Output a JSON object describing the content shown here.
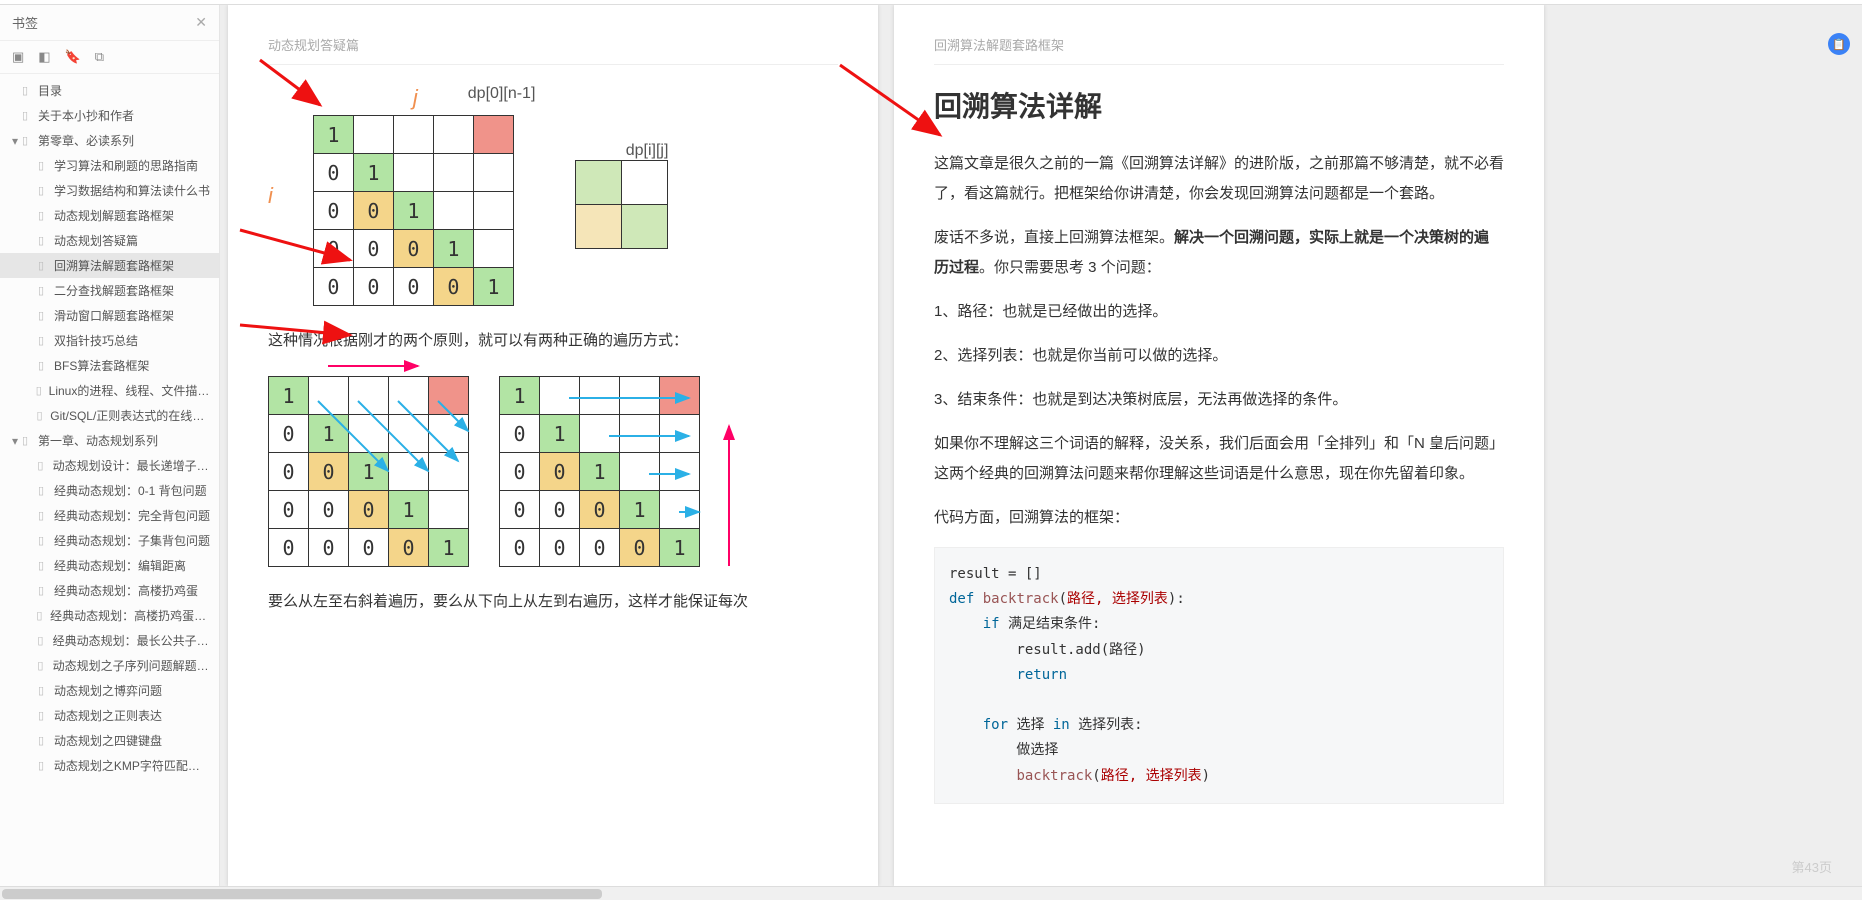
{
  "sidebar": {
    "title": "书签",
    "nodes": [
      {
        "label": "目录",
        "level": 0,
        "selected": false
      },
      {
        "label": "关于本小抄和作者",
        "level": 0
      },
      {
        "label": "第零章、必读系列",
        "level": 0,
        "expandable": true
      },
      {
        "label": "学习算法和刷题的思路指南",
        "level": 1
      },
      {
        "label": "学习数据结构和算法读什么书",
        "level": 1
      },
      {
        "label": "动态规划解题套路框架",
        "level": 1
      },
      {
        "label": "动态规划答疑篇",
        "level": 1
      },
      {
        "label": "回溯算法解题套路框架",
        "level": 1,
        "selected": true
      },
      {
        "label": "二分查找解题套路框架",
        "level": 1
      },
      {
        "label": "滑动窗口解题套路框架",
        "level": 1
      },
      {
        "label": "双指针技巧总结",
        "level": 1
      },
      {
        "label": "BFS算法套路框架",
        "level": 1
      },
      {
        "label": "Linux的进程、线程、文件描述符是什…",
        "level": 1
      },
      {
        "label": "Git/SQL/正则表达式的在线练习平台",
        "level": 1
      },
      {
        "label": "第一章、动态规划系列",
        "level": 0,
        "expandable": true
      },
      {
        "label": "动态规划设计：最长递增子序列",
        "level": 1
      },
      {
        "label": "经典动态规划：0-1 背包问题",
        "level": 1
      },
      {
        "label": "经典动态规划：完全背包问题",
        "level": 1
      },
      {
        "label": "经典动态规划：子集背包问题",
        "level": 1
      },
      {
        "label": "经典动态规划：编辑距离",
        "level": 1
      },
      {
        "label": "经典动态规划：高楼扔鸡蛋",
        "level": 1
      },
      {
        "label": "经典动态规划：高楼扔鸡蛋（进阶）",
        "level": 1
      },
      {
        "label": "经典动态规划：最长公共子序列",
        "level": 1
      },
      {
        "label": "动态规划之子序列问题解题模板",
        "level": 1
      },
      {
        "label": "动态规划之博弈问题",
        "level": 1
      },
      {
        "label": "动态规划之正则表达",
        "level": 1
      },
      {
        "label": "动态规划之四键键盘",
        "level": 1
      },
      {
        "label": "动态规划之KMP字符匹配算法",
        "level": 1
      }
    ]
  },
  "leftPage": {
    "header": "动态规划答疑篇",
    "axis_j": "j",
    "axis_i": "i",
    "dp_top": "dp[0][n-1]",
    "dp_small": "dp[i][j]",
    "mainGrid": [
      [
        {
          "v": "1",
          "c": "cg"
        },
        {
          "v": "",
          "c": ""
        },
        {
          "v": "",
          "c": ""
        },
        {
          "v": "",
          "c": ""
        },
        {
          "v": "",
          "c": "cr"
        }
      ],
      [
        {
          "v": "0",
          "c": ""
        },
        {
          "v": "1",
          "c": "cg"
        },
        {
          "v": "",
          "c": ""
        },
        {
          "v": "",
          "c": ""
        },
        {
          "v": "",
          "c": ""
        }
      ],
      [
        {
          "v": "0",
          "c": ""
        },
        {
          "v": "0",
          "c": "cy"
        },
        {
          "v": "1",
          "c": "cg"
        },
        {
          "v": "",
          "c": ""
        },
        {
          "v": "",
          "c": ""
        }
      ],
      [
        {
          "v": "0",
          "c": ""
        },
        {
          "v": "0",
          "c": ""
        },
        {
          "v": "0",
          "c": "cy"
        },
        {
          "v": "1",
          "c": "cg"
        },
        {
          "v": "",
          "c": ""
        }
      ],
      [
        {
          "v": "0",
          "c": ""
        },
        {
          "v": "0",
          "c": ""
        },
        {
          "v": "0",
          "c": ""
        },
        {
          "v": "0",
          "c": "cy"
        },
        {
          "v": "1",
          "c": "cg"
        }
      ]
    ],
    "smallGrid": [
      [
        {
          "c": "cgl"
        },
        {
          "c": ""
        }
      ],
      [
        {
          "c": "cyl"
        },
        {
          "c": "cgl"
        }
      ]
    ],
    "para1": "这种情况根据刚才的两个原则，就可以有两种正确的遍历方式：",
    "para2": "要么从左至右斜着遍历，要么从下向上从左到右遍历，这样才能保证每次"
  },
  "rightPage": {
    "header": "回溯算法解题套路框架",
    "title": "回溯算法详解",
    "p1": "这篇文章是很久之前的一篇《回溯算法详解》的进阶版，之前那篇不够清楚，就不必看了，看这篇就行。把框架给你讲清楚，你会发现回溯算法问题都是一个套路。",
    "p2a": "废话不多说，直接上回溯算法框架。",
    "p2b": "解决一个回溯问题，实际上就是一个决策树的遍历过程",
    "p2c": "。你只需要思考 3 个问题：",
    "li1": "1、路径：也就是已经做出的选择。",
    "li2": "2、选择列表：也就是你当前可以做的选择。",
    "li3": "3、结束条件：也就是到达决策树底层，无法再做选择的条件。",
    "p3": "如果你不理解这三个词语的解释，没关系，我们后面会用「全排列」和「N 皇后问题」这两个经典的回溯算法问题来帮你理解这些词语是什么意思，现在你先留着印象。",
    "p4": "代码方面，回溯算法的框架：",
    "code": "result = []\ndef backtrack(路径, 选择列表):\n    if 满足结束条件:\n        result.add(路径)\n        return\n\n    for 选择 in 选择列表:\n        做选择\n        backtrack(路径, 选择列表)"
  },
  "footer": {
    "pageLabel": "第43页"
  },
  "chart_data": {
    "type": "table",
    "description": "5x5 lower-triangular DP matrix illustration",
    "rows": [
      [
        "1",
        "",
        "",
        "",
        ""
      ],
      [
        "0",
        "1",
        "",
        "",
        ""
      ],
      [
        "0",
        "0",
        "1",
        "",
        ""
      ],
      [
        "0",
        "0",
        "0",
        "1",
        ""
      ],
      [
        "0",
        "0",
        "0",
        "0",
        "1"
      ]
    ],
    "highlight_top_right": "dp[0][n-1]",
    "sub_table": "2x2 dp[i][j] dependency cells"
  }
}
